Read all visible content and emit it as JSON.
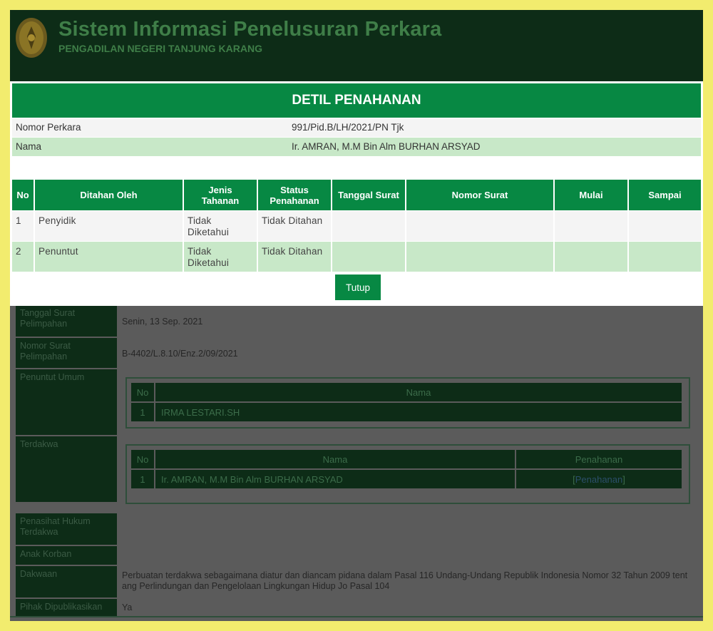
{
  "header": {
    "title": "Sistem Informasi Penelusuran Perkara",
    "subtitle": "PENGADILAN NEGERI TANJUNG KARANG"
  },
  "modal": {
    "title": "DETIL PENAHANAN",
    "info": [
      {
        "label": "Nomor Perkara",
        "value": "991/Pid.B/LH/2021/PN Tjk"
      },
      {
        "label": "Nama",
        "value": "Ir. AMRAN, M.M Bin Alm BURHAN ARSYAD"
      }
    ],
    "columns": [
      "No",
      "Ditahan Oleh",
      "Jenis Tahanan",
      "Status Penahanan",
      "Tanggal Surat",
      "Nomor Surat",
      "Mulai",
      "Sampai"
    ],
    "rows": [
      [
        "1",
        "Penyidik",
        "Tidak Diketahui",
        "Tidak Ditahan",
        "",
        "",
        "",
        ""
      ],
      [
        "2",
        "Penuntut",
        "Tidak Diketahui",
        "Tidak Ditahan",
        "",
        "",
        "",
        ""
      ]
    ],
    "close_label": "Tutup"
  },
  "background": {
    "fields": [
      {
        "label": "Tanggal Surat Pelimpahan",
        "value": "Senin, 13 Sep. 2021"
      },
      {
        "label": "Nomor Surat Pelimpahan",
        "value": "B-4402/L.8.10/Enz.2/09/2021"
      },
      {
        "label": "Penuntut Umum",
        "value": ""
      },
      {
        "label": "Terdakwa",
        "value": ""
      },
      {
        "label": "Penasihat Hukum Terdakwa",
        "value": ""
      },
      {
        "label": "Anak Korban",
        "value": ""
      },
      {
        "label": "Dakwaan",
        "value": "Perbuatan terdakwa sebagaimana diatur dan diancam pidana dalam Pasal 116 Undang-Undang Republik Indonesia Nomor 32 Tahun 2009 tentang Perlindungan dan Pengelolaan Lingkungan Hidup Jo Pasal 104"
      },
      {
        "label": "Pihak Dipublikasikan",
        "value": "Ya"
      }
    ],
    "penuntut_table": {
      "columns": [
        "No",
        "Nama"
      ],
      "rows": [
        [
          "1",
          "IRMA LESTARI.SH"
        ]
      ]
    },
    "terdakwa_table": {
      "columns": [
        "No",
        "Nama",
        "Penahanan"
      ],
      "rows": [
        [
          "1",
          "Ir. AMRAN, M.M Bin Alm BURHAN ARSYAD",
          "Penahanan"
        ]
      ]
    }
  },
  "colors": {
    "primary_green": "#078843",
    "header_dark": "#0d2c17",
    "row_alt": "#c8e8c8",
    "page_border": "#f2ec6e"
  }
}
